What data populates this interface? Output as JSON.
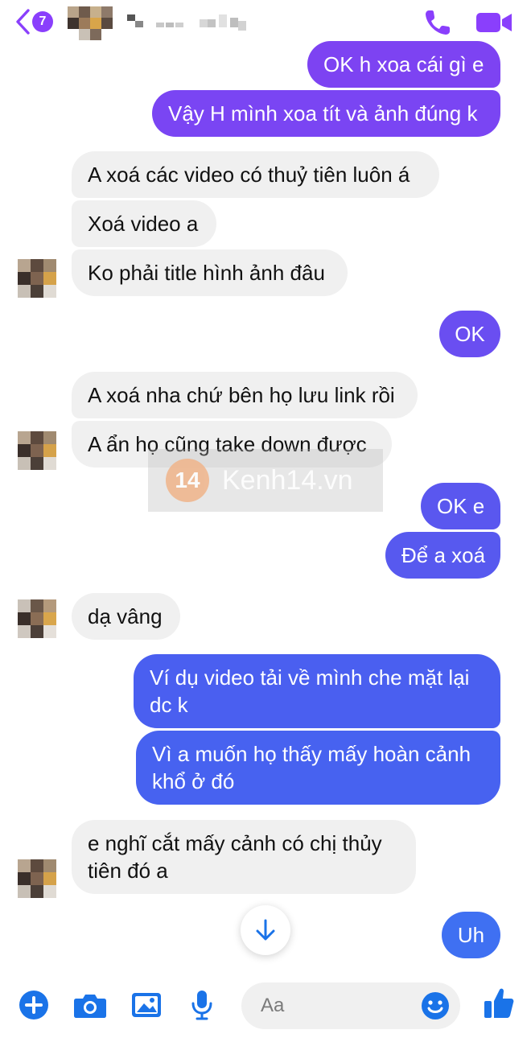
{
  "header": {
    "unread_count": "7",
    "contact_name": "",
    "accent_color": "#8a3ffc"
  },
  "messages": [
    {
      "direction": "outgoing",
      "text": "OK h xoa cái gì e",
      "color": "#7d43f2"
    },
    {
      "direction": "outgoing",
      "text": "Vậy H mình xoa tít và ảnh đúng k",
      "color": "#7a45f3"
    },
    {
      "direction": "incoming",
      "text": "A xoá các video có thuỷ tiên luôn á"
    },
    {
      "direction": "incoming",
      "text": "Xoá video a"
    },
    {
      "direction": "incoming",
      "text": "Ko phải title hình ảnh đâu"
    },
    {
      "direction": "outgoing",
      "text": "OK",
      "color": "#6a4ef1"
    },
    {
      "direction": "incoming",
      "text": "A xoá nha chứ bên họ lưu link rồi"
    },
    {
      "direction": "incoming",
      "text": "A ẩn họ cũng take down được"
    },
    {
      "direction": "outgoing",
      "text": "OK e",
      "color": "#5a57ef"
    },
    {
      "direction": "outgoing",
      "text": "Để a xoá",
      "color": "#5759ef"
    },
    {
      "direction": "incoming",
      "text": "dạ vâng"
    },
    {
      "direction": "outgoing",
      "text": "Ví dụ video tải về mình che mặt lại dc k",
      "color": "#4a5ff0"
    },
    {
      "direction": "outgoing",
      "text": "Vì a muốn họ thấy mấy hoàn cảnh khổ ở đó",
      "color": "#4762f0"
    },
    {
      "direction": "incoming",
      "text": "e nghĩ cắt mấy cảnh có chị thủy tiên đó a"
    },
    {
      "direction": "outgoing",
      "text": "Uh",
      "color": "#3f70f2"
    }
  ],
  "watermark": {
    "logo": "14",
    "text": "Kenh14.vn"
  },
  "composer": {
    "placeholder": "Aa",
    "icons": [
      "plus-icon",
      "camera-icon",
      "image-icon",
      "microphone-icon",
      "emoji-icon",
      "thumbs-up-icon"
    ],
    "icon_color": "#1a73e8"
  }
}
